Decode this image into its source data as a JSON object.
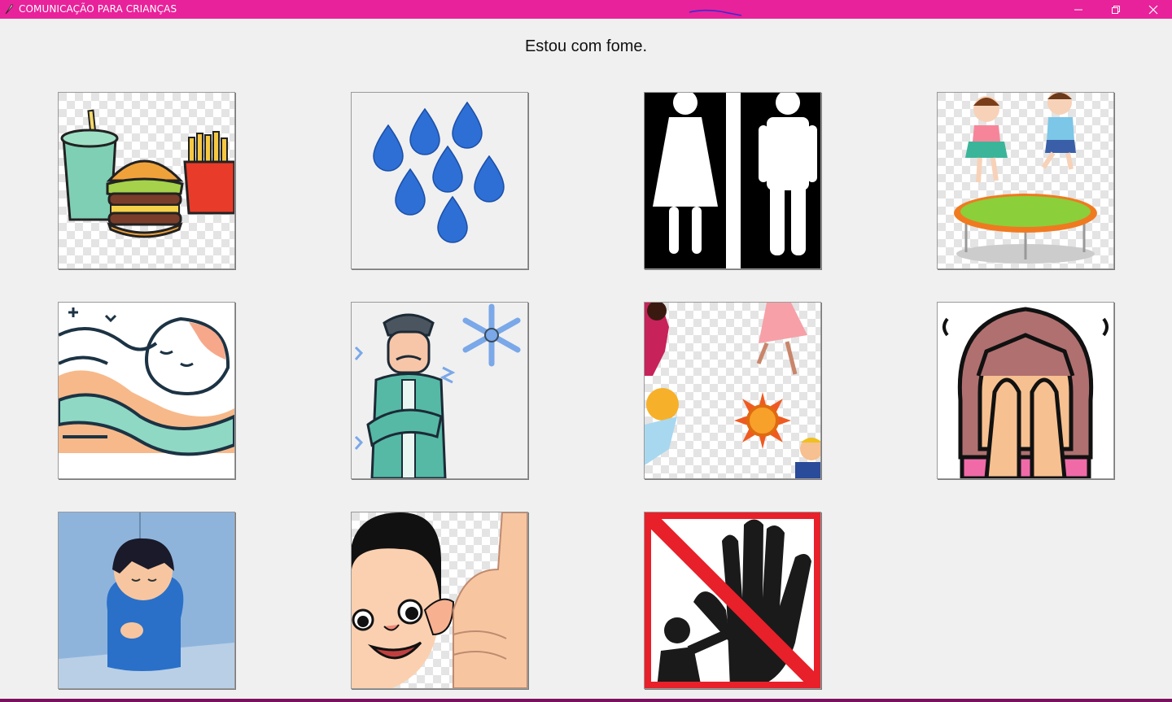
{
  "window": {
    "title": "COMUNICAÇÃO PARA CRIANÇAS",
    "accent_color": "#e8229a",
    "icons": [
      "app-feather-icon",
      "minimize-icon",
      "restore-icon",
      "close-icon"
    ]
  },
  "message": "Estou com fome.",
  "cards": [
    {
      "name": "food",
      "icon": "food-icon"
    },
    {
      "name": "water",
      "icon": "water-drops-icon"
    },
    {
      "name": "bathroom",
      "icon": "restroom-icon"
    },
    {
      "name": "play",
      "icon": "trampoline-kids-icon"
    },
    {
      "name": "sleep",
      "icon": "sleeping-child-icon"
    },
    {
      "name": "cold",
      "icon": "cold-person-icon"
    },
    {
      "name": "hot",
      "icon": "hot-sun-icon"
    },
    {
      "name": "ashamed",
      "icon": "face-in-hands-icon"
    },
    {
      "name": "sad",
      "icon": "sad-child-icon"
    },
    {
      "name": "ok",
      "icon": "thumbs-up-boy-icon"
    },
    {
      "name": "stop",
      "icon": "stop-hand-icon"
    }
  ]
}
